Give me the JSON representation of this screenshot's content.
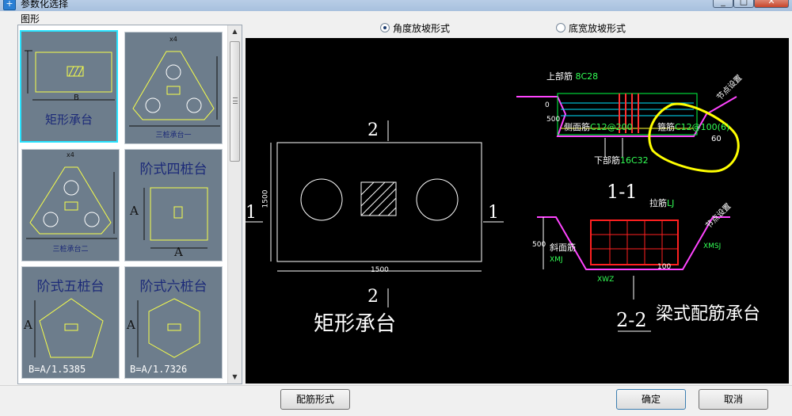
{
  "window": {
    "title": "参数化选择",
    "icon": "app-icon",
    "buttons": {
      "min": "_",
      "max": "□",
      "close": "✕"
    }
  },
  "left_panel": {
    "label": "图形",
    "thumbnails": [
      {
        "name": "矩形承台",
        "selected": true,
        "labels": {
          "dim": "B"
        }
      },
      {
        "name": "三桩承台一",
        "selected": false,
        "labels": {
          "dim": "x4"
        }
      },
      {
        "name": "三桩承台二",
        "selected": false,
        "labels": {
          "dim": "x4"
        }
      },
      {
        "name": "阶式四桩台",
        "selected": false,
        "labels": {
          "side": "A",
          "bottom": "A"
        }
      },
      {
        "name": "阶式五桩台",
        "selected": false,
        "labels": {
          "side": "A",
          "formula": "B=A/1.5385"
        }
      },
      {
        "name": "阶式六桩台",
        "selected": false,
        "labels": {
          "side": "A",
          "formula": "B=A/1.7326"
        }
      }
    ]
  },
  "options": {
    "radio1": {
      "label": "角度放坡形式",
      "checked": true
    },
    "radio2": {
      "label": "底宽放坡形式",
      "checked": false
    }
  },
  "preview": {
    "title_left": "矩形承台",
    "title_right": "梁式配筋承台",
    "plan": {
      "width_label": "1500",
      "height_label": "1500",
      "sec_top": "2",
      "sec_bottom": "2",
      "sec_left": "1",
      "sec_right": "1"
    },
    "section1": {
      "label": "1-1",
      "top_bar": "上部筋",
      "top_bar_val": "8C28",
      "side_bar": "侧面筋",
      "side_bar_val": "C12@200",
      "stirrup": "箍筋",
      "stirrup_val": "C12@100(6)",
      "bottom_bar": "下部筋",
      "bottom_bar_val": "16C32",
      "angle": "60",
      "dim_a": "0",
      "dim_b": "500",
      "slope_label": "节点设置"
    },
    "section2": {
      "label": "2-2",
      "tie_bar": "拉筋",
      "tie_bar_val": "LJ",
      "slope_bar": "斜面筋",
      "slope_bar_val": "XMJ",
      "xwz": "XWZ",
      "xmsj": "XMSJ",
      "dim_500": "500",
      "dim_100": "100",
      "slope_label": "节点设置"
    }
  },
  "buttons": {
    "rebar_form": "配筋形式",
    "ok": "确定",
    "cancel": "取消"
  },
  "colors": {
    "thumb_bg": "#6d7d8c",
    "selected_border": "#29e3ff",
    "preview_bg": "#000000",
    "highlight_ring": "#ffff00"
  }
}
